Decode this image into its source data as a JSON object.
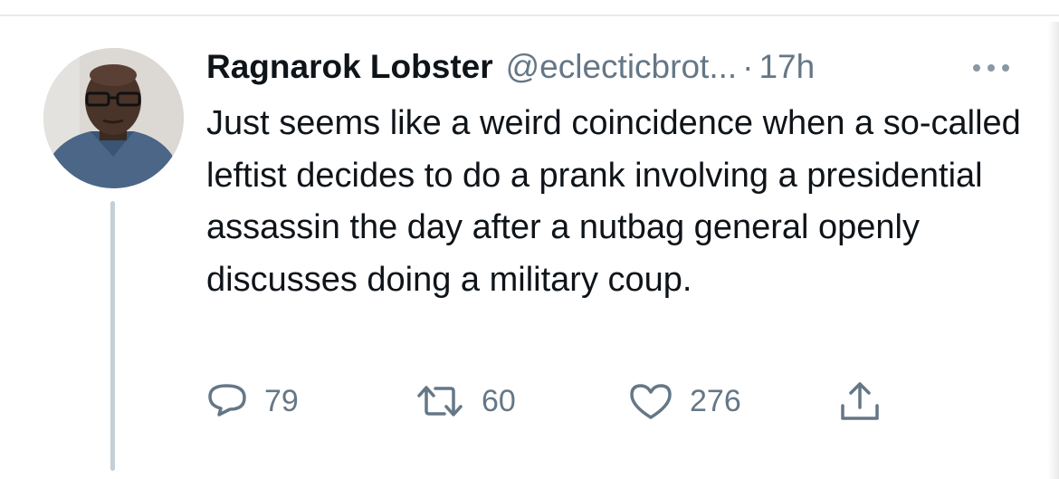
{
  "tweet": {
    "display_name": "Ragnarok Lobster",
    "handle": "@eclecticbrot...",
    "separator": "·",
    "time": "17h",
    "text": "Just seems like a weird coincidence when a so-called leftist decides to do a prank involving a presidential assassin the day after a nutbag general openly discusses doing a military coup.",
    "more_icon": "more-horizontal-icon"
  },
  "actions": {
    "reply_count": "79",
    "retweet_count": "60",
    "like_count": "276",
    "reply_icon": "reply-icon",
    "retweet_icon": "retweet-icon",
    "like_icon": "heart-icon",
    "share_icon": "share-icon"
  },
  "colors": {
    "text": "#0f1419",
    "secondary": "#657786",
    "thread_line": "#c4cfd6"
  }
}
